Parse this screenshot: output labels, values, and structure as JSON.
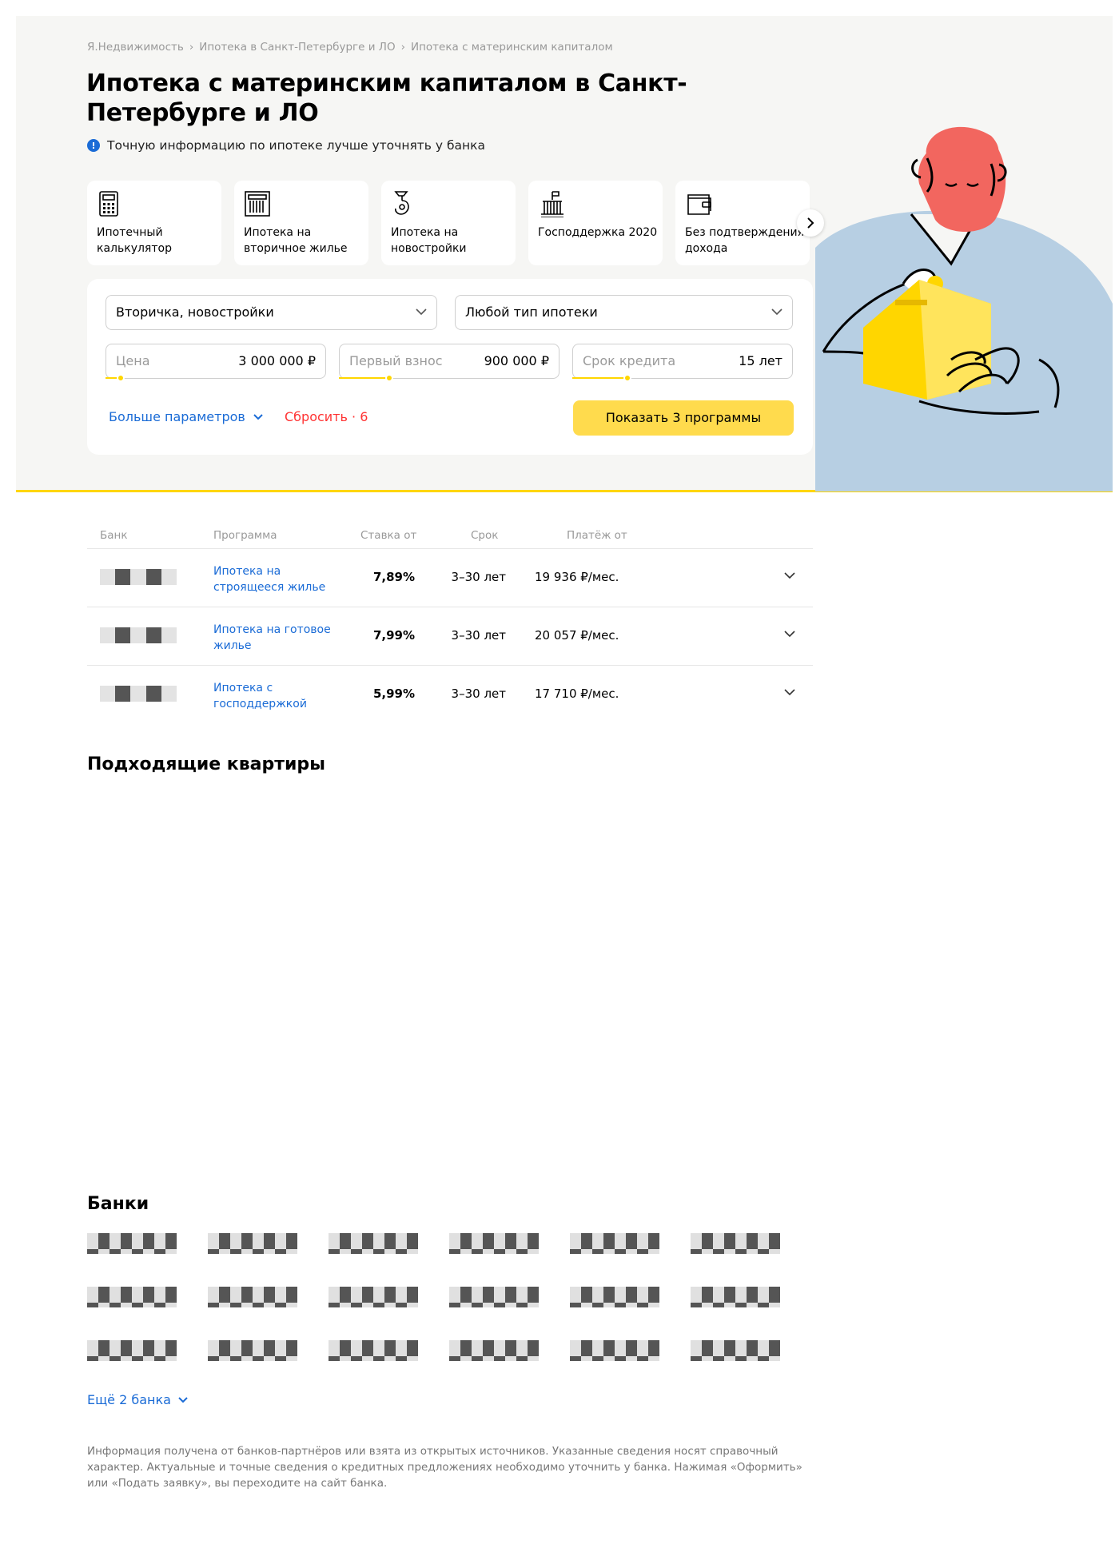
{
  "breadcrumbs": [
    "Я.Недвижимость",
    "Ипотека в Санкт-Петербурге и ЛО",
    "Ипотека с материнским капиталом"
  ],
  "breadcrumb_separator": "›",
  "page_title": "Ипотека с материнским капиталом в Санкт-Петербурге и ЛО",
  "notice": {
    "icon": "!",
    "text": "Точную информацию по ипотеке лучше уточнять у банка"
  },
  "categories": [
    {
      "label": "Ипотечный калькулятор",
      "icon": "calculator-icon"
    },
    {
      "label": "Ипотека на вторичное жилье",
      "icon": "building-icon"
    },
    {
      "label": "Ипотека на новостройки",
      "icon": "crane-hook-icon"
    },
    {
      "label": "Господдержка 2020",
      "icon": "government-building-icon"
    },
    {
      "label": "Без подтверждения дохода",
      "icon": "wallet-icon"
    }
  ],
  "filters": {
    "property_type": "Вторичка, новостройки",
    "mortgage_type": "Любой тип ипотеки",
    "price": {
      "placeholder": "Цена",
      "value": "3 000 000 ₽",
      "slider_fraction": 0.07
    },
    "down_payment": {
      "placeholder": "Первый взнос",
      "value": "900 000 ₽",
      "slider_fraction": 0.23
    },
    "term": {
      "placeholder": "Срок кредита",
      "value": "15 лет",
      "slider_fraction": 0.25
    },
    "more_params": "Больше параметров",
    "reset": "Сбросить · 6",
    "submit": "Показать 3 программы"
  },
  "table": {
    "headers": {
      "bank": "Банк",
      "program": "Программа",
      "rate": "Ставка от",
      "term": "Срок",
      "payment": "Платёж от"
    },
    "rows": [
      {
        "program": "Ипотека на строящееся жилье",
        "rate": "7,89%",
        "term": "3–30 лет",
        "payment": "19 936 ₽/мес."
      },
      {
        "program": "Ипотека на готовое жилье",
        "rate": "7,99%",
        "term": "3–30 лет",
        "payment": "20 057 ₽/мес."
      },
      {
        "program": "Ипотека с господдержкой",
        "rate": "5,99%",
        "term": "3–30 лет",
        "payment": "17 710 ₽/мес."
      }
    ]
  },
  "apartments_title": "Подходящие квартиры",
  "banks_title": "Банки",
  "banks_count_shown": 18,
  "more_banks": "Ещё 2 банка",
  "disclaimer": "Информация получена от банков-партнёров или взята из открытых источников. Указанные сведения носят справочный характер. Актуальные и точные сведения о кредитных предложениях необходимо уточнить у банка. Нажимая «Оформить» или «Подать заявку», вы переходите на сайт банка.",
  "colors": {
    "accent_yellow": "#ffd600",
    "button_yellow": "#ffdb4d",
    "link_blue": "#1a6bd6",
    "reset_red": "#ff3333",
    "hero_bg": "#f6f6f4"
  }
}
